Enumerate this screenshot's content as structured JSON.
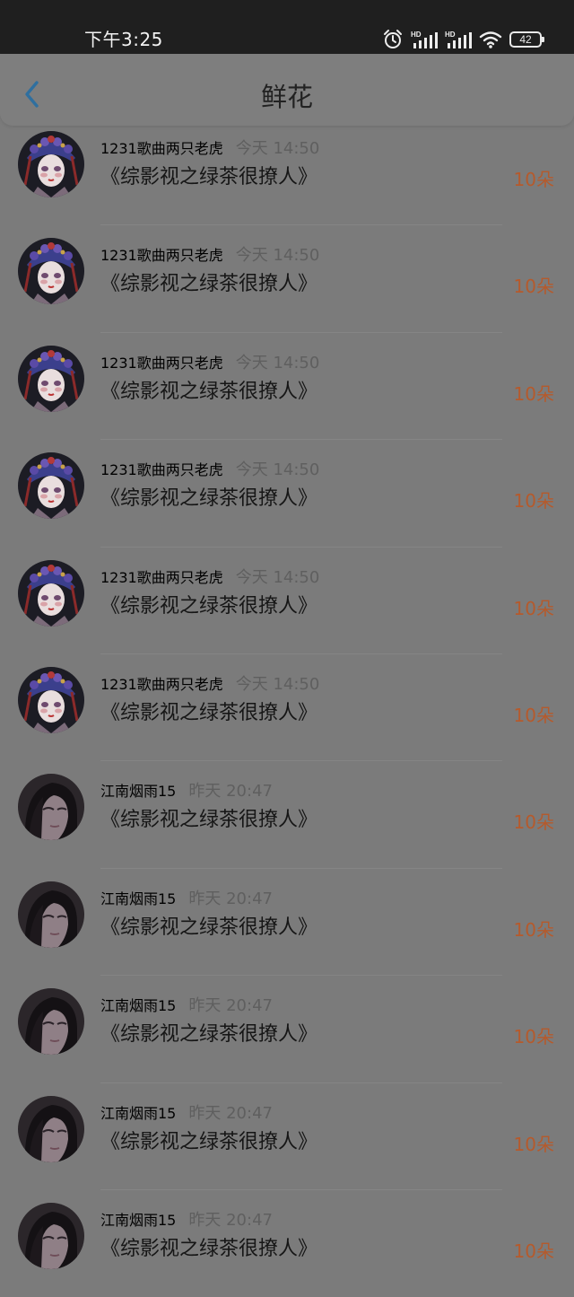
{
  "status_bar": {
    "time": "下午3:25",
    "battery": "42",
    "icons": [
      "alarm-icon",
      "hd-signal-icon",
      "hd-signal-icon",
      "wifi-icon",
      "battery-icon"
    ]
  },
  "header": {
    "title": "鲜花",
    "back_icon": "chevron-left-icon"
  },
  "colors": {
    "overlay_background": "#7b7b7b",
    "status_bar": "#1f1f1f",
    "back_icon": "#2f6f9f",
    "flower_count": "#b55a2c"
  },
  "items": [
    {
      "user": "1231歌曲两只老虎",
      "time": "今天 14:50",
      "book": "《综影视之绿茶很撩人》",
      "count": "10朵",
      "avatar": "opera-avatar"
    },
    {
      "user": "1231歌曲两只老虎",
      "time": "今天 14:50",
      "book": "《综影视之绿茶很撩人》",
      "count": "10朵",
      "avatar": "opera-avatar"
    },
    {
      "user": "1231歌曲两只老虎",
      "time": "今天 14:50",
      "book": "《综影视之绿茶很撩人》",
      "count": "10朵",
      "avatar": "opera-avatar"
    },
    {
      "user": "1231歌曲两只老虎",
      "time": "今天 14:50",
      "book": "《综影视之绿茶很撩人》",
      "count": "10朵",
      "avatar": "opera-avatar"
    },
    {
      "user": "1231歌曲两只老虎",
      "time": "今天 14:50",
      "book": "《综影视之绿茶很撩人》",
      "count": "10朵",
      "avatar": "opera-avatar"
    },
    {
      "user": "1231歌曲两只老虎",
      "time": "今天 14:50",
      "book": "《综影视之绿茶很撩人》",
      "count": "10朵",
      "avatar": "opera-avatar"
    },
    {
      "user": "江南烟雨15",
      "time": "昨天 20:47",
      "book": "《综影视之绿茶很撩人》",
      "count": "10朵",
      "avatar": "portrait-avatar"
    },
    {
      "user": "江南烟雨15",
      "time": "昨天 20:47",
      "book": "《综影视之绿茶很撩人》",
      "count": "10朵",
      "avatar": "portrait-avatar"
    },
    {
      "user": "江南烟雨15",
      "time": "昨天 20:47",
      "book": "《综影视之绿茶很撩人》",
      "count": "10朵",
      "avatar": "portrait-avatar"
    },
    {
      "user": "江南烟雨15",
      "time": "昨天 20:47",
      "book": "《综影视之绿茶很撩人》",
      "count": "10朵",
      "avatar": "portrait-avatar"
    },
    {
      "user": "江南烟雨15",
      "time": "昨天 20:47",
      "book": "《综影视之绿茶很撩人》",
      "count": "10朵",
      "avatar": "portrait-avatar"
    }
  ]
}
